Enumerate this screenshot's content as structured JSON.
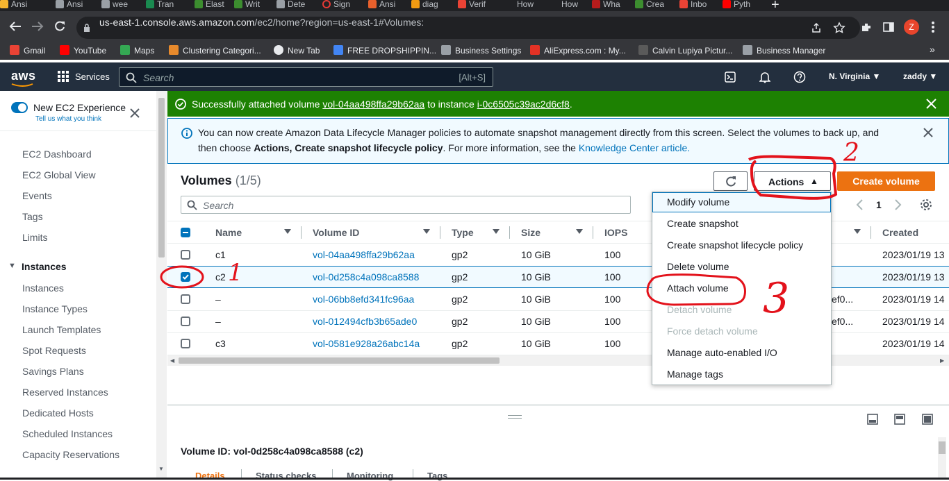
{
  "browser": {
    "tabs": [
      "Ansi",
      "wee",
      "Tran",
      "Elast",
      "Writ",
      "Dete",
      "Sign",
      "Ansi",
      "diag",
      "Verif",
      "How",
      "How",
      "Wha",
      "Crea",
      "Inbo",
      "Pyth"
    ],
    "url_host": "us-east-1.console.aws.amazon.com",
    "url_path": "/ec2/home?region=us-east-1#Volumes:",
    "profile_initial": "Z",
    "bookmarks": [
      "Gmail",
      "YouTube",
      "Maps",
      "Clustering Categori...",
      "New Tab",
      "FREE DROPSHIPPIN...",
      "Business Settings",
      "AliExpress.com : My...",
      "Calvin Lupiya Pictur...",
      "Business Manager"
    ],
    "more_bookmarks": "»"
  },
  "aws": {
    "logo": "aws",
    "services": "Services",
    "search_placeholder": "Search",
    "search_shortcut": "[Alt+S]",
    "region": "N. Virginia",
    "user": "zaddy"
  },
  "sidebar": {
    "new_experience": "New EC2 Experience",
    "tell_us": "Tell us what you think",
    "items": [
      "EC2 Dashboard",
      "EC2 Global View",
      "Events",
      "Tags",
      "Limits"
    ],
    "section": "Instances",
    "section_items": [
      "Instances",
      "Instance Types",
      "Launch Templates",
      "Spot Requests",
      "Savings Plans",
      "Reserved Instances",
      "Dedicated Hosts",
      "Scheduled Instances",
      "Capacity Reservations"
    ]
  },
  "flash": {
    "prefix": "Successfully attached volume",
    "volume": "vol-04aa498ffa29b62aa",
    "middle": "to instance",
    "instance": "i-0c6505c39ac2d6cf8",
    "suffix": "."
  },
  "info": {
    "line1": "You can now create Amazon Data Lifecycle Manager policies to automate snapshot management directly from this screen. Select the volumes to back up, and",
    "line2_pre": "then choose",
    "line2_bold": "Actions, Create snapshot lifecycle policy",
    "line2_mid": ". For more information, see the",
    "line2_link": "Knowledge Center article."
  },
  "volumes": {
    "title": "Volumes",
    "count": "(1/5)",
    "actions_label": "Actions",
    "create_label": "Create volume",
    "search_placeholder": "Search",
    "page": "1",
    "columns": [
      "Name",
      "Volume ID",
      "Type",
      "Size",
      "IOPS",
      "Created"
    ],
    "rows": [
      {
        "name": "c1",
        "id": "vol-04aa498ffa29b62aa",
        "type": "gp2",
        "size": "10 GiB",
        "iops": "100",
        "extra": "",
        "created": "2023/01/19 13",
        "checked": false
      },
      {
        "name": "c2",
        "id": "vol-0d258c4a098ca8588",
        "type": "gp2",
        "size": "10 GiB",
        "iops": "100",
        "extra": "",
        "created": "2023/01/19 13",
        "checked": true
      },
      {
        "name": "–",
        "id": "vol-06bb8efd341fc96aa",
        "type": "gp2",
        "size": "10 GiB",
        "iops": "100",
        "extra": "ef0...",
        "created": "2023/01/19 14",
        "checked": false
      },
      {
        "name": "–",
        "id": "vol-012494cfb3b65ade0",
        "type": "gp2",
        "size": "10 GiB",
        "iops": "100",
        "extra": "ef0...",
        "created": "2023/01/19 14",
        "checked": false
      },
      {
        "name": "c3",
        "id": "vol-0581e928a26abc14a",
        "type": "gp2",
        "size": "10 GiB",
        "iops": "100",
        "extra": "",
        "created": "2023/01/19 14",
        "checked": false
      }
    ]
  },
  "menu": {
    "items": [
      "Modify volume",
      "Create snapshot",
      "Create snapshot lifecycle policy",
      "Delete volume",
      "Attach volume",
      "Detach volume",
      "Force detach volume",
      "Manage auto-enabled I/O",
      "Manage tags"
    ],
    "disabled": [
      false,
      false,
      false,
      false,
      false,
      true,
      true,
      false,
      false
    ]
  },
  "details": {
    "title": "Volume ID: vol-0d258c4a098ca8588 (c2)",
    "tabs": [
      "Details",
      "Status checks",
      "Monitoring",
      "Tags"
    ]
  },
  "annotations": {
    "one": "1",
    "two": "2",
    "three": "3",
    "color": "#e3121b"
  }
}
